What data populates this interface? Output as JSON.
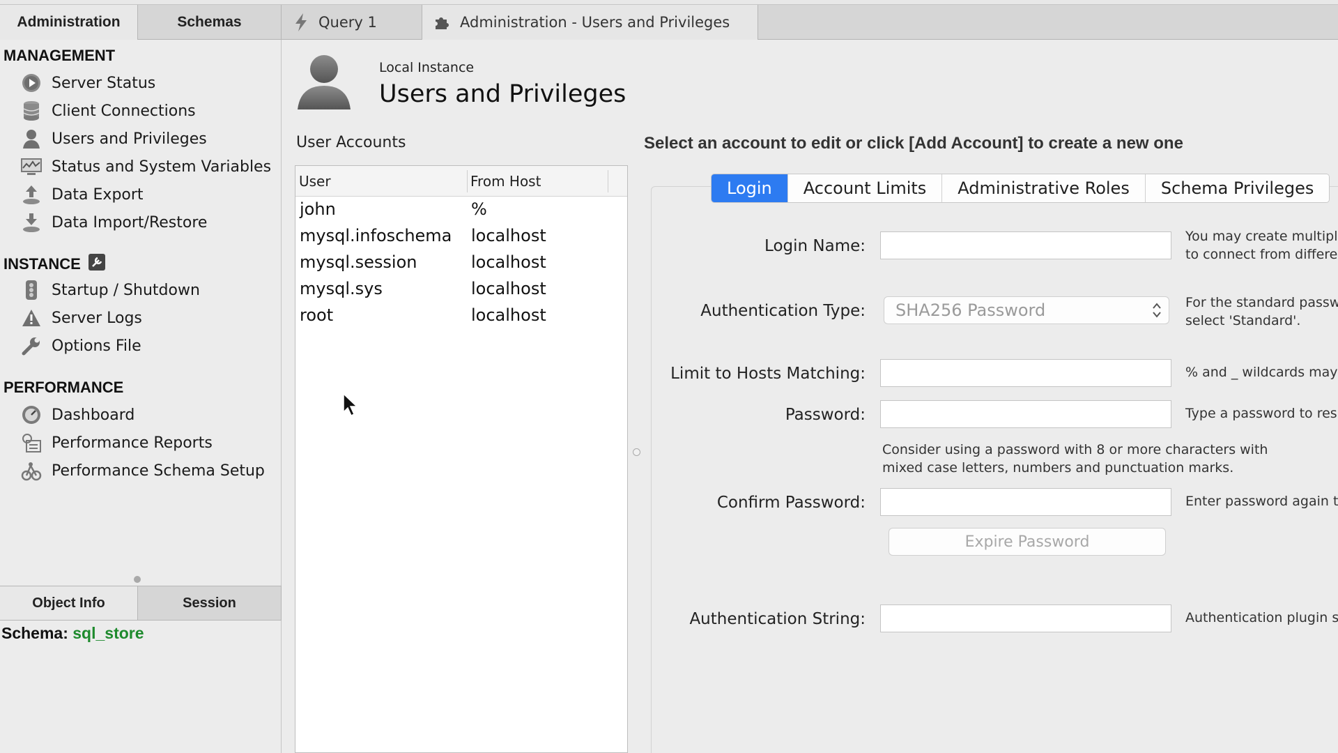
{
  "top_tabs": {
    "administration": "Administration",
    "schemas": "Schemas"
  },
  "query_tabs": [
    {
      "label": "Query 1"
    },
    {
      "label": "Administration - Users and Privileges"
    }
  ],
  "sidebar": {
    "management": {
      "title": "MANAGEMENT",
      "items": [
        {
          "label": "Server Status",
          "icon": "play-circle-icon"
        },
        {
          "label": "Client Connections",
          "icon": "database-icon"
        },
        {
          "label": "Users and Privileges",
          "icon": "user-icon"
        },
        {
          "label": "Status and System Variables",
          "icon": "monitor-icon"
        },
        {
          "label": "Data Export",
          "icon": "export-icon"
        },
        {
          "label": "Data Import/Restore",
          "icon": "import-icon"
        }
      ]
    },
    "instance": {
      "title": "INSTANCE",
      "items": [
        {
          "label": "Startup / Shutdown",
          "icon": "traffic-light-icon"
        },
        {
          "label": "Server Logs",
          "icon": "warning-icon"
        },
        {
          "label": "Options File",
          "icon": "wrench-icon"
        }
      ]
    },
    "performance": {
      "title": "PERFORMANCE",
      "items": [
        {
          "label": "Dashboard",
          "icon": "gauge-icon"
        },
        {
          "label": "Performance Reports",
          "icon": "reports-icon"
        },
        {
          "label": "Performance Schema Setup",
          "icon": "schema-setup-icon"
        }
      ]
    },
    "lower_tabs": {
      "object_info": "Object Info",
      "session": "Session"
    },
    "schema": {
      "label": "Schema:",
      "value": "sql_store"
    }
  },
  "header": {
    "subtitle": "Local Instance",
    "title": "Users and Privileges"
  },
  "user_accounts": {
    "label": "User Accounts",
    "columns": [
      "User",
      "From Host"
    ],
    "rows": [
      {
        "user": "john",
        "host": "%"
      },
      {
        "user": "mysql.infoschema",
        "host": "localhost"
      },
      {
        "user": "mysql.session",
        "host": "localhost"
      },
      {
        "user": "mysql.sys",
        "host": "localhost"
      },
      {
        "user": "root",
        "host": "localhost"
      }
    ]
  },
  "editor": {
    "hint": "Select an account to edit or click [Add Account] to create a new one",
    "tabs": [
      "Login",
      "Account Limits",
      "Administrative Roles",
      "Schema Privileges"
    ],
    "active_tab": "Login",
    "accent": "#2d7bf1",
    "fields": {
      "login_name": {
        "label": "Login Name:",
        "value": "",
        "note1": "You may create multipl",
        "note2": "to connect from differe"
      },
      "auth_type": {
        "label": "Authentication Type:",
        "value": "SHA256 Password",
        "note1": "For the standard passw",
        "note2": "select 'Standard'."
      },
      "limit_hosts": {
        "label": "Limit to Hosts Matching:",
        "value": "",
        "note1": "% and _ wildcards may"
      },
      "password": {
        "label": "Password:",
        "value": "",
        "note1": "Type a password to res"
      },
      "password_hint1": "Consider using a password with 8 or more characters with",
      "password_hint2": "mixed case letters, numbers and punctuation marks.",
      "confirm_password": {
        "label": "Confirm Password:",
        "value": "",
        "note1": "Enter password again t"
      },
      "expire_button": "Expire Password",
      "auth_string": {
        "label": "Authentication String:",
        "value": "",
        "note1": "Authentication plugin s"
      }
    }
  }
}
